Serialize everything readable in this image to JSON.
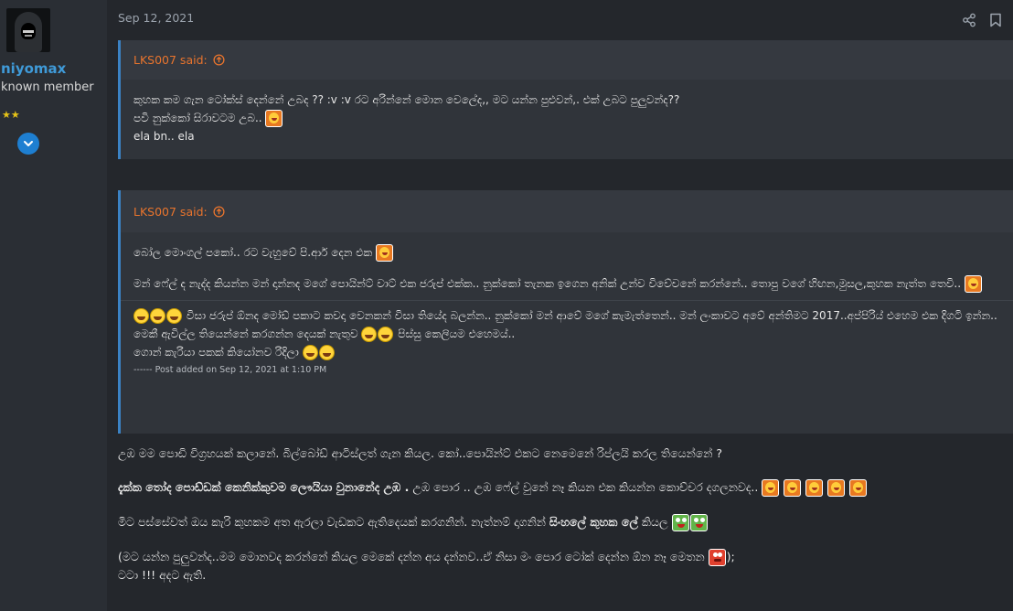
{
  "user": {
    "name": "niyomax",
    "title": "known member",
    "stars": "★★"
  },
  "post": {
    "date": "Sep 12, 2021"
  },
  "quote1": {
    "author": "LKS007 said:",
    "line1": "කුහක කම ගැන ටෝක්ස් දෙන්නේ උබද ?? :v :v රට අරින්නේ මොන වෙලේද,, මට යන්න පුළුවන්,. එක් උබට පුලුවන්ද??",
    "line2": "පවි නුක්කෝ සිරාවටම උබ..",
    "line3": "ela bn.. ela"
  },
  "quote2": {
    "author": "LKS007 said:",
    "line1": "බෝල මොංගල් පකෝ.. රට වැහුවේ පි.ආර් දෙන එක",
    "line2": "මන් ෆේල් ද නැද්ද කියන්න මන් දාන්නද මගේ පොයින්ට් වාට් එක ජරුප් එක්ක.. නුක්කෝ තැනක ඉගෙන අනික් උන්ව විවේචනේ කරන්නේ.. තොපු වගේ හිඟන,මුසල,කුහක නැත්ත තෙවි..",
    "line3": "විසා ජරුප් ඕනද මෝඩ් පකාට කවදා වෙනකන් විසා තියේද බලන්න.. නුක්කෝ මන් ආවේ මගේ කැමැත්තෙන්.. මන් ලංකාවට අවේ අන්තිමට 2017..අප්පිරිය් එහෙම එක දිගටි ඉන්න..",
    "line4": "මෙකී ඇවිල්ල තියෙන්නේ කරගන්න දෙයක් නැතුව",
    "line4b": "පිස්සු කෙලියම එහෙමය්..",
    "line5": "ගොන් කැරියා පකක් කියෝනව රිදිලා",
    "added": "------ Post added on Sep 12, 2021 at 1:10 PM"
  },
  "reply": {
    "p1": "උඹ මම පොඩි විග්‍රහයක් කලානේ. බිල්බෝඩ් ආටිස්ලත් ගැන කියල. කෝ..පොයින්ට් එකට නෙමෙනේ රිප්ලයි කරල තියෙන්නේ ?",
    "p2_bold": "දැක්ක තෝද පොඩ්ඩක් කෙනික්කුවම ලෞයියා වුනානේද උඹ .",
    "p2_rest": "උඹ පොර .. උඹ ෆේල් වුනේ නෑ කියන එක කියන්න කොච්චර දගලනවද..",
    "p3": "මිට පස්සේවත් ඔය කැරි කුහකම අත ඇරලා වැඩකට ඇතිදෙයක් කරගනින්. නැත්නම් දාගනින්",
    "p3_bold": "සිංහලේ කුහක ලේ",
    "p3_end": "කියල",
    "p4": "(මට යන්න පුලුවන්ද..මම මොනවද කරන්නේ කියල මෙකේ දන්න අය දන්නව..ඒ නිසා මං පොර ටෝක් දෙන්න ඕන නෑ මෙතන",
    "p4_end": ");",
    "p5": "ටටා !!! අදට ඇති."
  },
  "icons": {
    "share": "share-icon",
    "bookmark": "bookmark-icon",
    "expand": "chevron-down-icon",
    "quote_arrow": "arrow-up-circle-icon"
  },
  "colors": {
    "accent": "#3f9ad8",
    "quote_author": "#e8742d",
    "quote_border": "#3b82c4"
  }
}
